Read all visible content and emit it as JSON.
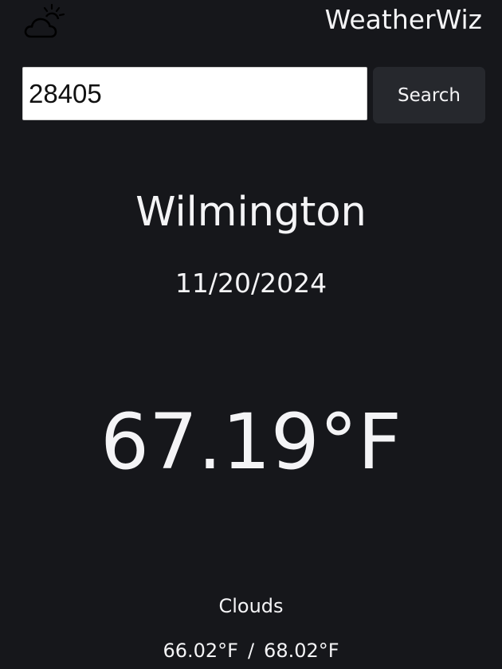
{
  "header": {
    "logo_icon": "cloud-sun-icon",
    "brand": "WeatherWiz"
  },
  "search": {
    "value": "28405",
    "button_label": "Search"
  },
  "weather": {
    "city": "Wilmington",
    "date": "11/20/2024",
    "temperature": "67.19°F",
    "condition": "Clouds",
    "low": "66.02°F",
    "separator": "/",
    "high": "68.02°F"
  },
  "colors": {
    "background": "#16171b",
    "text": "#f4f4f6",
    "button_background": "#26282d",
    "input_background": "#ffffff"
  }
}
